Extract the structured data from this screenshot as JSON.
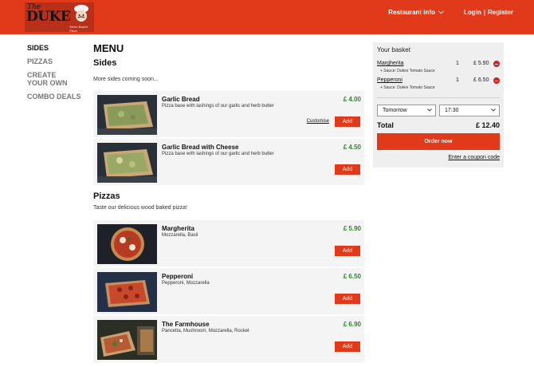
{
  "header": {
    "logo": {
      "top_word": "The",
      "main_word": "DUKE",
      "tagline": "Stone Baked Pizza"
    },
    "restaurant_info": "Restaurant info",
    "login": "Login",
    "separator": "|",
    "register": "Register"
  },
  "sidebar": {
    "items": [
      {
        "label": "SIDES",
        "active": true
      },
      {
        "label": "PIZZAS",
        "active": false
      },
      {
        "label": "CREATE YOUR OWN",
        "active": false
      },
      {
        "label": "COMBO DEALS",
        "active": false
      }
    ]
  },
  "menu": {
    "title": "MENU",
    "sections": [
      {
        "title": "Sides",
        "subtitle": "More sides coming soon...",
        "items": [
          {
            "name": "Garlic Bread",
            "description": "Pizza base with lashings of our garlic and herb butter",
            "price": "£ 4.00",
            "customise": "Customise",
            "add": "Add"
          },
          {
            "name": "Garlic Bread with Cheese",
            "description": "Pizza base with lashings of our garlic and herb butter",
            "price": "£ 4.50",
            "add": "Add"
          }
        ]
      },
      {
        "title": "Pizzas",
        "subtitle": "Taste our delicious wood baked pizza!",
        "items": [
          {
            "name": "Margherita",
            "description": "Mozzarella, Basil",
            "price": "£ 5.90",
            "add": "Add"
          },
          {
            "name": "Pepperoni",
            "description": "Pepperoni, Mozzarella",
            "price": "£ 6.50",
            "add": "Add"
          },
          {
            "name": "The Farmhouse",
            "description": "Pancetta, Mushroom, Mozzarella, Rocket",
            "price": "£ 6.90",
            "add": "Add"
          }
        ]
      }
    ]
  },
  "basket": {
    "title": "Your basket",
    "items": [
      {
        "name": "Margherita",
        "sauce": "+ Sauce: Dukes Tomato Sauce",
        "qty": "1",
        "price": "£ 5.90"
      },
      {
        "name": "Pepperoni",
        "sauce": "+ Sauce: Dukes Tomato Sauce",
        "qty": "1",
        "price": "£ 6.50"
      }
    ],
    "day": "Tomorrow",
    "time": "17:30",
    "total_label": "Total",
    "total_value": "£ 12.40",
    "order_button": "Order now",
    "coupon_link": "Enter a coupon code"
  },
  "colors": {
    "brand": "#e03a1a",
    "price": "#2a8a2a",
    "remove": "#d42020"
  }
}
